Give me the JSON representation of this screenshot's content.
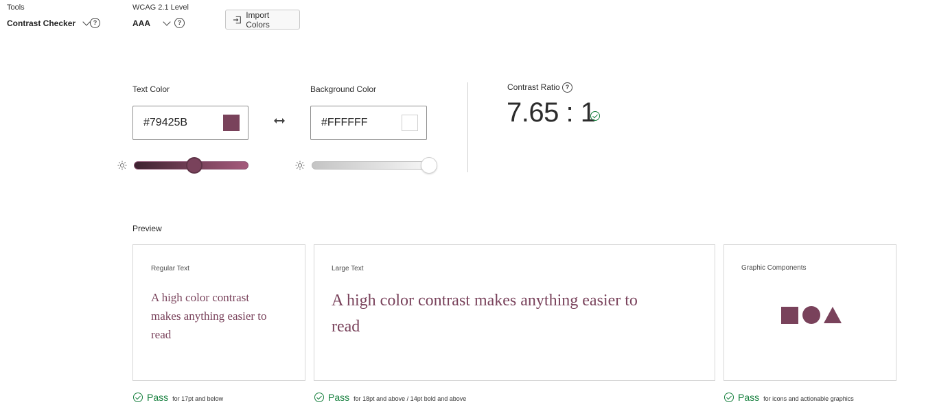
{
  "toolbar": {
    "tools_label": "Tools",
    "tools_value": "Contrast Checker",
    "wcag_label": "WCAG 2.1 Level",
    "wcag_value": "AAA",
    "import_label": "Import Colors"
  },
  "colors": {
    "text_label": "Text Color",
    "text_value": "#79425B",
    "background_label": "Background Color",
    "background_value": "#FFFFFF",
    "accent": "#79425B",
    "pass_green": "#137e3b"
  },
  "sliders": {
    "text_brightness": 0.5,
    "background_brightness": 1.0
  },
  "contrast": {
    "label": "Contrast Ratio",
    "value": "7.65 : 1"
  },
  "preview": {
    "heading": "Preview",
    "cards": [
      {
        "label": "Regular Text",
        "sample": "A high color contrast makes anything easier to read",
        "pass": "Pass",
        "note": "for 17pt and below"
      },
      {
        "label": "Large Text",
        "sample": "A high color contrast makes anything easier to read",
        "pass": "Pass",
        "note": "for 18pt and above / 14pt bold and above"
      },
      {
        "label": "Graphic Components",
        "pass": "Pass",
        "note": "for icons and actionable graphics"
      }
    ]
  }
}
